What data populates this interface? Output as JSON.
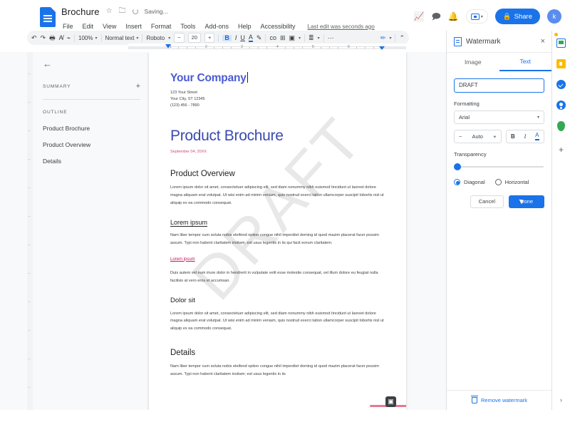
{
  "titlebar": {
    "doc_title": "Brochure",
    "star_icon": "star-icon",
    "move_icon": "move-to-folder-icon",
    "saving_text": "Saving...",
    "menus": [
      "File",
      "Edit",
      "View",
      "Insert",
      "Format",
      "Tools",
      "Add-ons",
      "Help",
      "Accessibility"
    ],
    "last_edit": "Last edit was seconds ago",
    "trend_icon": "activity-icon",
    "comment_icon": "comment-icon",
    "bell_icon": "notifications-icon",
    "meet_caret": "▾",
    "share_label": "Share",
    "share_lock_icon": "lock-icon",
    "avatar_initial": "k",
    "accent_color": "#1a73e8"
  },
  "toolbar": {
    "undo": "↶",
    "redo": "↷",
    "print": "🖶",
    "spellcheck": "A̸",
    "paint_format": "⌁",
    "zoom_value": "100%",
    "style_value": "Normal text",
    "font_value": "Roboto",
    "font_size_minus": "−",
    "font_size_value": "20",
    "font_size_plus": "+",
    "bold": "B",
    "italic": "I",
    "underline": "U",
    "text_color": "A",
    "highlight": "✎",
    "link": "co",
    "comment": "⊞",
    "image": "▣",
    "align": "≣",
    "more": "⋯",
    "edit_mode": "✏",
    "collapse": "⌃"
  },
  "ruler": {
    "numbers": [
      "1",
      "2",
      "3",
      "4",
      "5",
      "6"
    ]
  },
  "outline": {
    "back_icon": "back-arrow-icon",
    "summary_label": "SUMMARY",
    "add_summary_icon": "+",
    "outline_label": "OUTLINE",
    "items": [
      {
        "label": "Product Brochure"
      },
      {
        "label": "Product Overview"
      },
      {
        "label": "Details"
      }
    ]
  },
  "document": {
    "watermark_overlay_text": "DRAFT",
    "company_name": "Your Company",
    "address_line1": "123 Your Street",
    "address_line2": "Your City, ST 12345",
    "address_line3": "(123) 456 - 7890",
    "title": "Product Brochure",
    "date": "September 04, 20XX",
    "company_color": "#4a5bd4",
    "title_color": "#3a4ab0",
    "date_color": "#d14b6e",
    "link_color": "#c2185b",
    "sections": [
      {
        "heading": "Product Overview",
        "body": "Lorem ipsum dolor sit amet, consectetuer adipiscing elit, sed diam nonummy nibh euismod tincidunt ut laoreet dolore magna aliquam erat volutpat. Ut wisi enim ad minim veniam, quis nostrud exerci tation ullamcorper suscipit lobortis nisl ut aliquip ex ea commodo consequat."
      },
      {
        "heading": "Lorem ipsum",
        "body": "Nam liber tempor cum soluta nobis eleifend option congue nihil imperdiet doming id quod mazim placerat facer possim assum. Typi non habent claritatem insitam; est usus legentis in iis qui facit eorum claritatem.",
        "link": "Lorem ipsum",
        "body2": "Duis autem vel eum iriure dolor in hendrerit in vulputate velit esse molestie consequat, vel illum dolore eu feugiat nulla facilisis at vero eros et accumsan."
      },
      {
        "heading": "Dolor sit",
        "body": "Lorem ipsum dolor sit amet, consectetuer adipiscing elit, sed diam nonummy nibh euismod tincidunt ut laoreet dolore magna aliquam erat volutpat. Ut wisi enim ad minim veniam, quis nostrud exerci tation ullamcorper suscipit lobortis nisl ut aliquip ex ea commodo consequat."
      },
      {
        "heading": "Details",
        "body": "Nam liber tempor cum soluta nobis eleifend option congue nihil imperdiet doming id quod mazim placerat facer possim assum. Typi non habent claritatem insitam; est usus legentis in iis"
      }
    ]
  },
  "watermark_panel": {
    "icon": "watermark-doc-icon",
    "title": "Watermark",
    "close_icon": "×",
    "tabs": [
      {
        "label": "Image",
        "active": false
      },
      {
        "label": "Text",
        "active": true
      }
    ],
    "text_value": "DRAFT",
    "formatting_label": "Formatting",
    "font_value": "Arial",
    "font_caret": "▾",
    "size_minus": "−",
    "size_value": "Auto",
    "size_plus": "+",
    "bold": "B",
    "italic": "I",
    "text_color": "A",
    "transparency_label": "Transparency",
    "transparency_value": 0,
    "orientation": [
      {
        "label": "Diagonal",
        "selected": true
      },
      {
        "label": "Horizontal",
        "selected": false
      }
    ],
    "cancel_label": "Cancel",
    "done_label": "Done",
    "remove_label": "Remove watermark",
    "remove_icon": "trash-icon"
  },
  "rail": {
    "icons": [
      "calendar-icon",
      "keep-icon",
      "tasks-icon",
      "contacts-icon",
      "maps-icon"
    ],
    "add_icon": "+",
    "expand_icon": "›"
  }
}
